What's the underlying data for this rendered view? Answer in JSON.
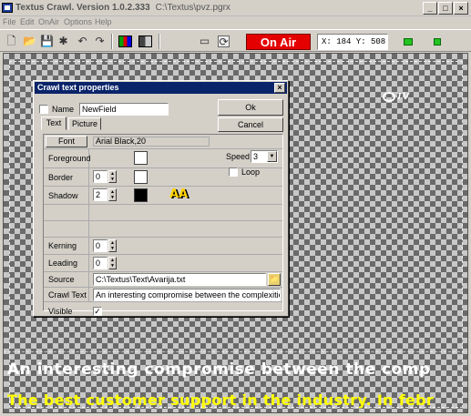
{
  "window": {
    "title": "Textus Crawl. Version 1.0.2.333",
    "path": "C:\\Textus\\pvz.pgrx",
    "min_glyph": "_",
    "max_glyph": "□",
    "close_glyph": "×"
  },
  "menu": {
    "items": [
      "File",
      "Edit",
      "OnAir",
      "Options",
      "Help"
    ]
  },
  "toolbar": {
    "onair_label": "On Air",
    "coords_text": "X: 184   Y: 508",
    "icons": {
      "new": "🗋",
      "open": "📂",
      "save": "💾",
      "settings": "✱",
      "undo": "↶",
      "redo": "↷",
      "colorbars": "▮",
      "split": "◧",
      "frame": "▭",
      "refresh": "⟳"
    }
  },
  "canvas": {
    "logo_text": "TV",
    "crawl_line1": "An interesting compromise between the comp",
    "crawl_line2": "The best customer support in the industry. In febr"
  },
  "dialog": {
    "title": "Crawl text properties",
    "close_glyph": "×",
    "name_label": "Name",
    "name_value": "NewField",
    "ok_label": "Ok",
    "cancel_label": "Cancel",
    "tabs": [
      "Text",
      "Picture"
    ],
    "font_button": "Font",
    "font_value": "Arial Black,20",
    "foreground_label": "Foreground",
    "border_label": "Border",
    "border_value": "0",
    "shadow_label": "Shadow",
    "shadow_value": "2",
    "speed_label": "Speed",
    "speed_value": "3",
    "loop_label": "Loop",
    "kerning_label": "Kerning",
    "kerning_value": "0",
    "leading_label": "Leading",
    "leading_value": "0",
    "source_label": "Source",
    "source_value": "C:\\Textus\\Text\\Avarija.txt",
    "crawltext_label": "Crawl Text",
    "crawltext_value": "An interesting compromise between the complexities",
    "visible_label": "Visible",
    "visible_check": "✓",
    "shadow_sample": "AA",
    "spin_up": "▲",
    "spin_down": "▼",
    "combo_arrow": "▼",
    "folder_glyph": "📁"
  },
  "colors": {
    "onair": "#e40000",
    "titlebar": "#0a246a",
    "crawl2": "#ffff00",
    "led": "#22c422"
  }
}
